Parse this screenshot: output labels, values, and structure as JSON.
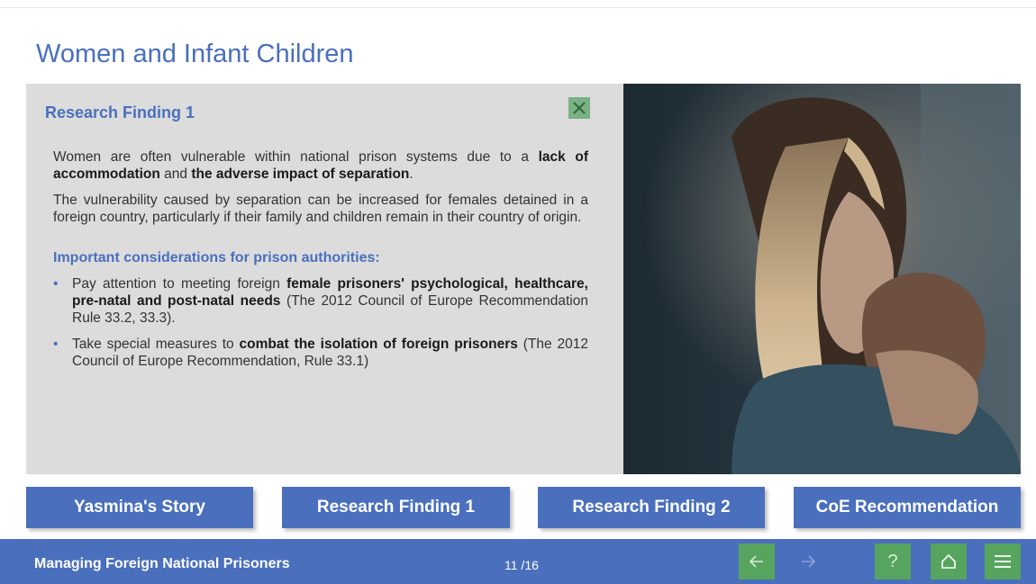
{
  "page": {
    "title": "Women and Infant Children"
  },
  "panel": {
    "title": "Research Finding 1",
    "close_icon": "close-x-icon",
    "para1": {
      "t1": "Women are often vulnerable within national prison systems due to a ",
      "b1": "lack of accommodation",
      "t2": " and ",
      "b2": "the adverse impact of separation",
      "t3": "."
    },
    "para2": "The vulnerability caused by separation can be increased for females detained in a foreign country, particularly if their family and children remain in their country of origin.",
    "considerations_heading": "Important considerations for prison authorities:",
    "bullets": [
      {
        "bullet": "•",
        "t1": "Pay attention to meeting foreign ",
        "b1": "female prisoners' psychological, healthcare, pre-natal and post-natal needs",
        "t2": " (The 2012 Council of Europe Recommendation Rule 33.2, 33.3)."
      },
      {
        "bullet": "•",
        "t1": "Take special measures to ",
        "b1": "combat the isolation of foreign prisoners",
        "t2": " (The 2012 Council of Europe Recommendation, Rule 33.1)"
      }
    ]
  },
  "nav_buttons": [
    {
      "label": "Yasmina's Story"
    },
    {
      "label": "Research Finding 1"
    },
    {
      "label": "Research Finding 2"
    },
    {
      "label": "CoE Recommendation"
    }
  ],
  "footer": {
    "course_title": "Managing Foreign National Prisoners",
    "page_count": "11 /16",
    "controls": {
      "back": "arrow-left-icon",
      "next": "arrow-right-icon",
      "help_label": "?",
      "home": "home-icon",
      "menu": "hamburger-menu-icon"
    }
  },
  "colors": {
    "accent": "#4a6fbd",
    "panel_bg": "#dcdcdc",
    "control_green": "#57a45f",
    "close_green": "#79b084"
  }
}
